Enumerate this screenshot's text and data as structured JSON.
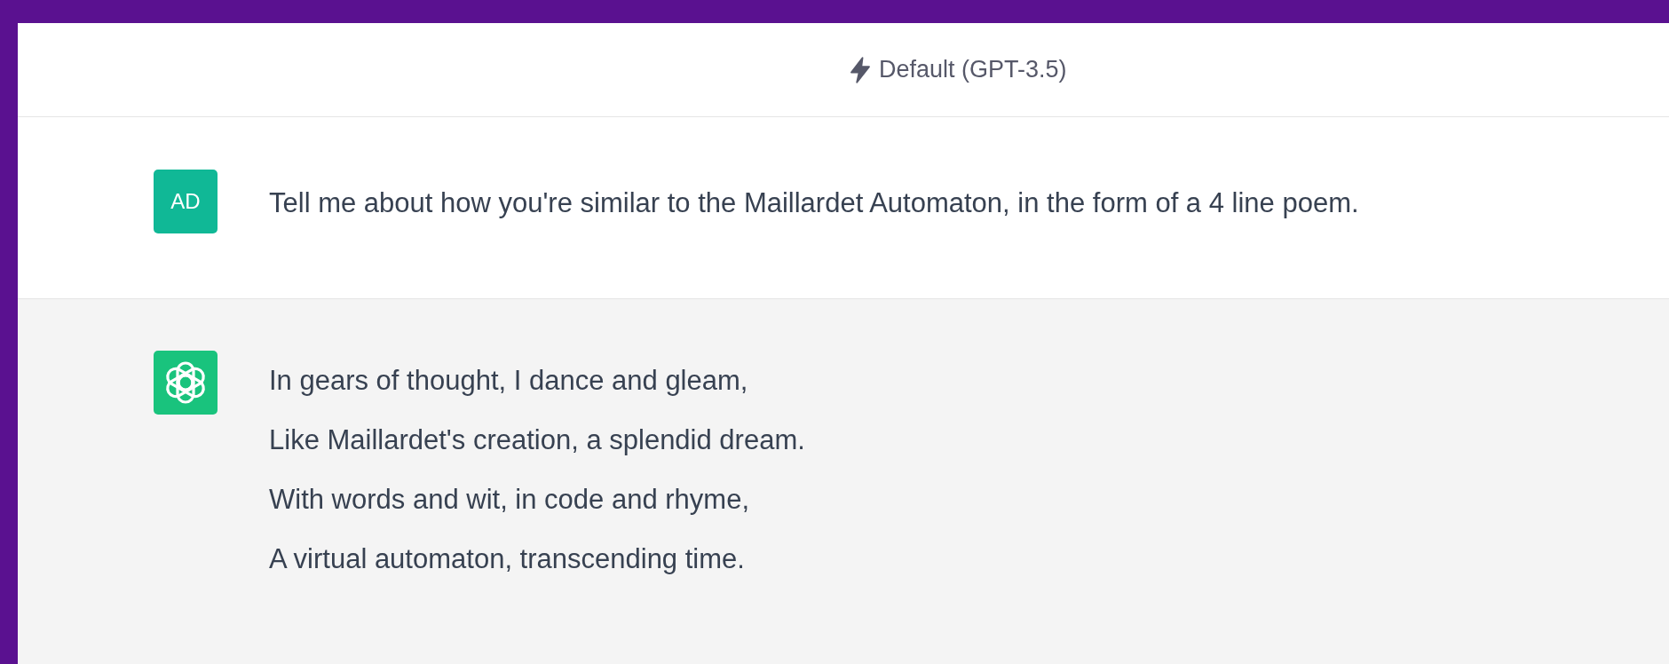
{
  "header": {
    "model": "Default (GPT-3.5)"
  },
  "messages": [
    {
      "kind": "user",
      "avatar": "AD",
      "lines": [
        "Tell me about how you're similar to the Maillardet Automaton, in the form of a 4 line poem."
      ]
    },
    {
      "kind": "assistant",
      "lines": [
        "In gears of thought, I dance and gleam,",
        "Like Maillardet's creation, a splendid dream.",
        "With words and wit, in code and rhyme,",
        "A virtual automaton, transcending time."
      ]
    }
  ]
}
